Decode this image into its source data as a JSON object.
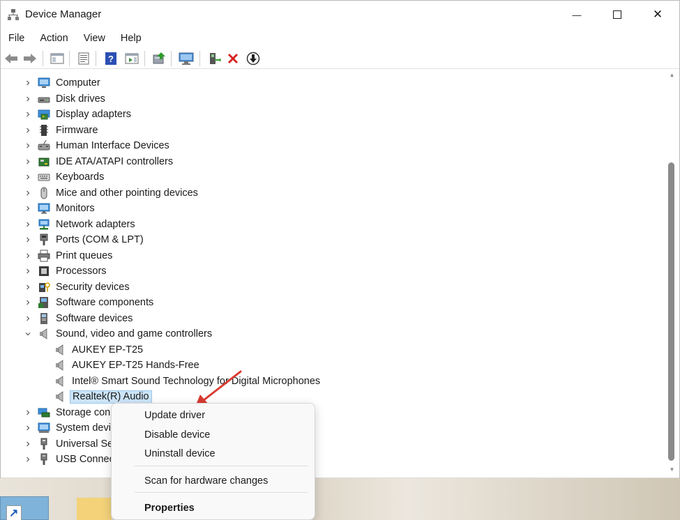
{
  "window": {
    "title": "Device Manager",
    "controls": {
      "minimize": "—",
      "close": "✕"
    }
  },
  "menu": [
    "File",
    "Action",
    "View",
    "Help"
  ],
  "toolbar": {
    "icons": [
      "back-icon",
      "forward-icon",
      "show-hide-console-tree-icon",
      "properties-icon",
      "help-icon",
      "action-pane-icon",
      "update-driver-icon",
      "scan-hardware-icon",
      "enable-device-icon",
      "uninstall-icon",
      "disable-device-icon"
    ]
  },
  "tree": {
    "items": [
      {
        "label": "Computer",
        "icon": "computer-icon",
        "expanded": false
      },
      {
        "label": "Disk drives",
        "icon": "disk-drive-icon",
        "expanded": false
      },
      {
        "label": "Display adapters",
        "icon": "display-adapter-icon",
        "expanded": false
      },
      {
        "label": "Firmware",
        "icon": "firmware-icon",
        "expanded": false
      },
      {
        "label": "Human Interface Devices",
        "icon": "hid-icon",
        "expanded": false
      },
      {
        "label": "IDE ATA/ATAPI controllers",
        "icon": "ide-controller-icon",
        "expanded": false
      },
      {
        "label": "Keyboards",
        "icon": "keyboard-icon",
        "expanded": false
      },
      {
        "label": "Mice and other pointing devices",
        "icon": "mouse-icon",
        "expanded": false
      },
      {
        "label": "Monitors",
        "icon": "monitor-icon",
        "expanded": false
      },
      {
        "label": "Network adapters",
        "icon": "network-adapter-icon",
        "expanded": false
      },
      {
        "label": "Ports (COM & LPT)",
        "icon": "port-icon",
        "expanded": false
      },
      {
        "label": "Print queues",
        "icon": "printer-icon",
        "expanded": false
      },
      {
        "label": "Processors",
        "icon": "processor-icon",
        "expanded": false
      },
      {
        "label": "Security devices",
        "icon": "security-device-icon",
        "expanded": false
      },
      {
        "label": "Software components",
        "icon": "software-component-icon",
        "expanded": false
      },
      {
        "label": "Software devices",
        "icon": "software-device-icon",
        "expanded": false
      },
      {
        "label": "Sound, video and game controllers",
        "icon": "speaker-icon",
        "expanded": true
      },
      {
        "label": "AUKEY EP-T25",
        "icon": "speaker-icon",
        "child": true
      },
      {
        "label": "AUKEY EP-T25 Hands-Free",
        "icon": "speaker-icon",
        "child": true
      },
      {
        "label": "Intel® Smart Sound Technology for Digital Microphones",
        "icon": "speaker-icon",
        "child": true
      },
      {
        "label": "Realtek(R) Audio",
        "icon": "speaker-icon",
        "child": true,
        "selected": true
      },
      {
        "label": "Storage con",
        "icon": "storage-controller-icon",
        "expanded": false
      },
      {
        "label": "System devi",
        "icon": "system-device-icon",
        "expanded": false
      },
      {
        "label": "Universal Se",
        "icon": "usb-controller-icon",
        "expanded": false
      },
      {
        "label": "USB Connec",
        "icon": "usb-connector-icon",
        "expanded": false
      }
    ]
  },
  "context_menu": {
    "items": [
      "Update driver",
      "Disable device",
      "Uninstall device",
      "Scan for hardware changes",
      "Properties"
    ]
  },
  "colors": {
    "selection_fill": "#cce4f7",
    "selection_border": "#99c9ef",
    "annotation_arrow": "#d93a30"
  }
}
